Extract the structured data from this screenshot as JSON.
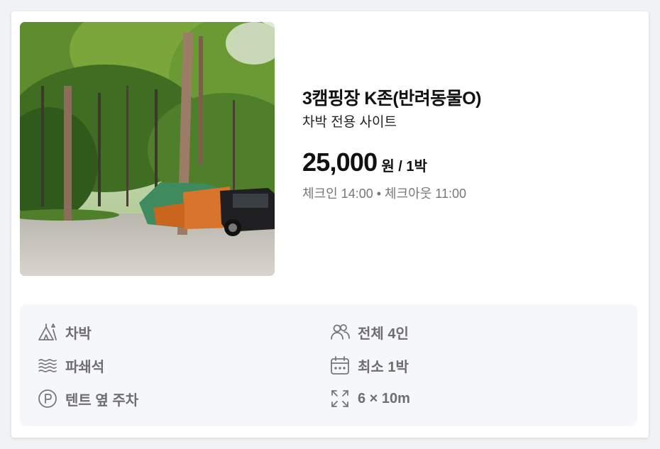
{
  "site": {
    "title": "3캠핑장 K존(반려동물O)",
    "subtitle": "차박 전용 사이트",
    "price": "25,000",
    "price_unit": "원 / 1박",
    "checkin_text": "체크인 14:00 • 체크아웃 11:00",
    "photo_alt": "camping site photo"
  },
  "features": [
    {
      "icon": "car-camping-icon",
      "label": "차박"
    },
    {
      "icon": "group-icon",
      "label": "전체 4인"
    },
    {
      "icon": "gravel-icon",
      "label": "파쇄석"
    },
    {
      "icon": "calendar-icon",
      "label": "최소 1박"
    },
    {
      "icon": "parking-icon",
      "label": "텐트 옆 주차"
    },
    {
      "icon": "expand-icon",
      "label": "6 × 10m"
    }
  ],
  "colors": {
    "feature_bg": "#f5f7fa",
    "feature_text": "#6e6e6e",
    "muted_text": "#777777"
  }
}
